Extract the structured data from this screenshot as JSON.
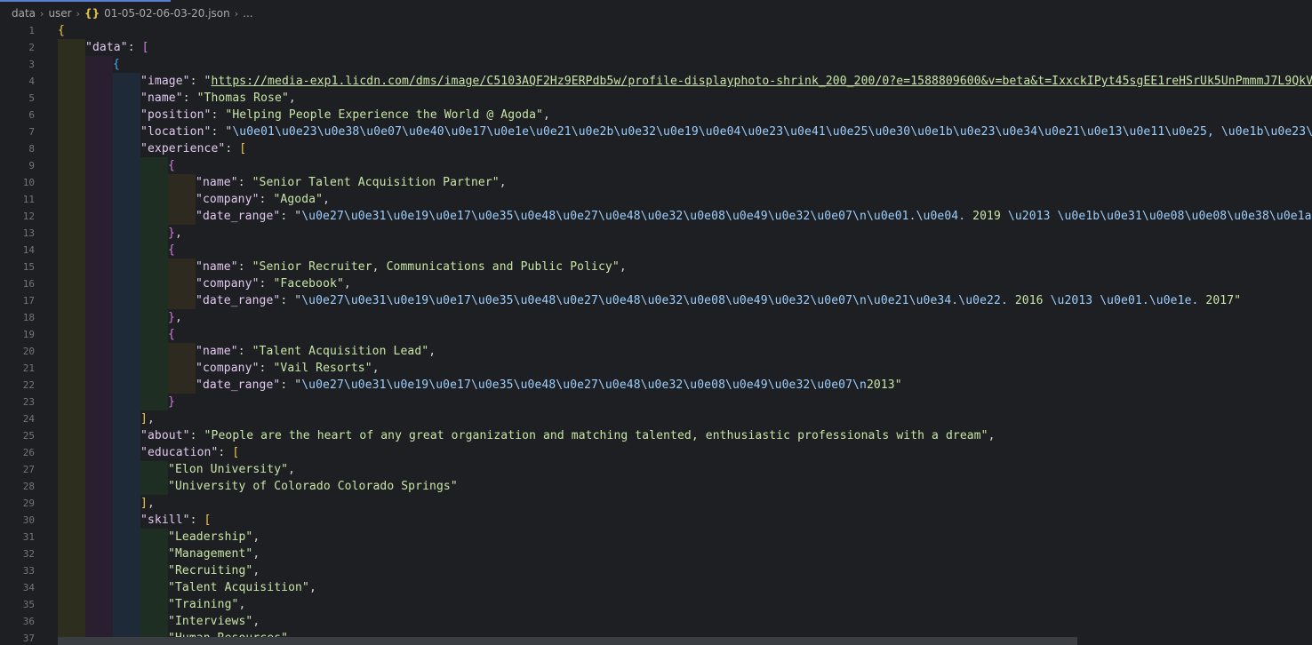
{
  "breadcrumb": {
    "items": [
      "data",
      "user"
    ],
    "file_icon": "{}",
    "file_name": "01-05-02-06-03-20.json",
    "ellipsis": "..."
  },
  "code_lines": [
    {
      "n": 1,
      "indent": 0,
      "tokens": [
        [
          "b1",
          "{"
        ]
      ]
    },
    {
      "n": 2,
      "indent": 1,
      "tokens": [
        [
          "k",
          "\"data\""
        ],
        [
          "p",
          ": "
        ],
        [
          "b2",
          "["
        ]
      ]
    },
    {
      "n": 3,
      "indent": 2,
      "tokens": [
        [
          "b3",
          "{"
        ]
      ]
    },
    {
      "n": 4,
      "indent": 3,
      "tokens": [
        [
          "k",
          "\"image\""
        ],
        [
          "p",
          ": \""
        ],
        [
          "url",
          "https://media-exp1.licdn.com/dms/image/C5103AQF2Hz9ERPdb5w/profile-displayphoto-shrink_200_200/0?e=1588809600&v=beta&t=IxxckIPyt45sgEE1reHSrUk5UnPmmmJ7L9QkV9q3TJ"
        ]
      ]
    },
    {
      "n": 5,
      "indent": 3,
      "tokens": [
        [
          "k",
          "\"name\""
        ],
        [
          "p",
          ": "
        ],
        [
          "s",
          "\"Thomas Rose\""
        ],
        [
          "p",
          ","
        ]
      ]
    },
    {
      "n": 6,
      "indent": 3,
      "tokens": [
        [
          "k",
          "\"position\""
        ],
        [
          "p",
          ": "
        ],
        [
          "s",
          "\"Helping People Experience the World @ Agoda\""
        ],
        [
          "p",
          ","
        ]
      ]
    },
    {
      "n": 7,
      "indent": 3,
      "tokens": [
        [
          "k",
          "\"location\""
        ],
        [
          "p",
          ": \""
        ],
        [
          "u",
          "\\u0e01\\u0e23\\u0e38\\u0e07\\u0e40\\u0e17\\u0e1e\\u0e21\\u0e2b\\u0e32\\u0e19\\u0e04\\u0e23\\u0e41\\u0e25\\u0e30\\u0e1b\\u0e23\\u0e34\\u0e21\\u0e13\\u0e11\\u0e25, \\u0e1b\\u0e23\\u0e30"
        ]
      ]
    },
    {
      "n": 8,
      "indent": 3,
      "tokens": [
        [
          "k",
          "\"experience\""
        ],
        [
          "p",
          ": "
        ],
        [
          "b1",
          "["
        ]
      ]
    },
    {
      "n": 9,
      "indent": 4,
      "tokens": [
        [
          "b2",
          "{"
        ]
      ]
    },
    {
      "n": 10,
      "indent": 5,
      "tokens": [
        [
          "k",
          "\"name\""
        ],
        [
          "p",
          ": "
        ],
        [
          "s",
          "\"Senior Talent Acquisition Partner\""
        ],
        [
          "p",
          ","
        ]
      ]
    },
    {
      "n": 11,
      "indent": 5,
      "tokens": [
        [
          "k",
          "\"company\""
        ],
        [
          "p",
          ": "
        ],
        [
          "s",
          "\"Agoda\""
        ],
        [
          "p",
          ","
        ]
      ]
    },
    {
      "n": 12,
      "indent": 5,
      "tokens": [
        [
          "k",
          "\"date_range\""
        ],
        [
          "p",
          ": \""
        ],
        [
          "u",
          "\\u0e27\\u0e31\\u0e19\\u0e17\\u0e35\\u0e48\\u0e27\\u0e48\\u0e32\\u0e08\\u0e49\\u0e32\\u0e07\\n\\u0e01.\\u0e04."
        ],
        [
          "s",
          " 2019 "
        ],
        [
          "u",
          "\\u2013 \\u0e1b\\u0e31\\u0e08\\u0e08\\u0e38\\u0e1a\\u0e31"
        ]
      ]
    },
    {
      "n": 13,
      "indent": 4,
      "tokens": [
        [
          "b2",
          "}"
        ],
        [
          "p",
          ","
        ]
      ]
    },
    {
      "n": 14,
      "indent": 4,
      "tokens": [
        [
          "b2",
          "{"
        ]
      ]
    },
    {
      "n": 15,
      "indent": 5,
      "tokens": [
        [
          "k",
          "\"name\""
        ],
        [
          "p",
          ": "
        ],
        [
          "s",
          "\"Senior Recruiter, Communications and Public Policy\""
        ],
        [
          "p",
          ","
        ]
      ]
    },
    {
      "n": 16,
      "indent": 5,
      "tokens": [
        [
          "k",
          "\"company\""
        ],
        [
          "p",
          ": "
        ],
        [
          "s",
          "\"Facebook\""
        ],
        [
          "p",
          ","
        ]
      ]
    },
    {
      "n": 17,
      "indent": 5,
      "tokens": [
        [
          "k",
          "\"date_range\""
        ],
        [
          "p",
          ": \""
        ],
        [
          "u",
          "\\u0e27\\u0e31\\u0e19\\u0e17\\u0e35\\u0e48\\u0e27\\u0e48\\u0e32\\u0e08\\u0e49\\u0e32\\u0e07\\n\\u0e21\\u0e34.\\u0e22."
        ],
        [
          "s",
          " 2016 "
        ],
        [
          "u",
          "\\u2013 \\u0e01.\\u0e1e."
        ],
        [
          "s",
          " 2017\""
        ]
      ]
    },
    {
      "n": 18,
      "indent": 4,
      "tokens": [
        [
          "b2",
          "}"
        ],
        [
          "p",
          ","
        ]
      ]
    },
    {
      "n": 19,
      "indent": 4,
      "tokens": [
        [
          "b2",
          "{"
        ]
      ]
    },
    {
      "n": 20,
      "indent": 5,
      "tokens": [
        [
          "k",
          "\"name\""
        ],
        [
          "p",
          ": "
        ],
        [
          "s",
          "\"Talent Acquisition Lead\""
        ],
        [
          "p",
          ","
        ]
      ]
    },
    {
      "n": 21,
      "indent": 5,
      "tokens": [
        [
          "k",
          "\"company\""
        ],
        [
          "p",
          ": "
        ],
        [
          "s",
          "\"Vail Resorts\""
        ],
        [
          "p",
          ","
        ]
      ]
    },
    {
      "n": 22,
      "indent": 5,
      "tokens": [
        [
          "k",
          "\"date_range\""
        ],
        [
          "p",
          ": \""
        ],
        [
          "u",
          "\\u0e27\\u0e31\\u0e19\\u0e17\\u0e35\\u0e48\\u0e27\\u0e48\\u0e32\\u0e08\\u0e49\\u0e32\\u0e07\\n"
        ],
        [
          "s",
          "2013\""
        ]
      ]
    },
    {
      "n": 23,
      "indent": 4,
      "tokens": [
        [
          "b2",
          "}"
        ]
      ]
    },
    {
      "n": 24,
      "indent": 3,
      "tokens": [
        [
          "b1",
          "]"
        ],
        [
          "p",
          ","
        ]
      ]
    },
    {
      "n": 25,
      "indent": 3,
      "tokens": [
        [
          "k",
          "\"about\""
        ],
        [
          "p",
          ": "
        ],
        [
          "s",
          "\"People are the heart of any great organization and matching talented, enthusiastic professionals with a dream\""
        ],
        [
          "p",
          ","
        ]
      ]
    },
    {
      "n": 26,
      "indent": 3,
      "tokens": [
        [
          "k",
          "\"education\""
        ],
        [
          "p",
          ": "
        ],
        [
          "b1",
          "["
        ]
      ]
    },
    {
      "n": 27,
      "indent": 4,
      "tokens": [
        [
          "s",
          "\"Elon University\""
        ],
        [
          "p",
          ","
        ]
      ]
    },
    {
      "n": 28,
      "indent": 4,
      "tokens": [
        [
          "s",
          "\"University of Colorado Colorado Springs\""
        ]
      ]
    },
    {
      "n": 29,
      "indent": 3,
      "tokens": [
        [
          "b1",
          "]"
        ],
        [
          "p",
          ","
        ]
      ]
    },
    {
      "n": 30,
      "indent": 3,
      "tokens": [
        [
          "k",
          "\"skill\""
        ],
        [
          "p",
          ": "
        ],
        [
          "b1",
          "["
        ]
      ]
    },
    {
      "n": 31,
      "indent": 4,
      "tokens": [
        [
          "s",
          "\"Leadership\""
        ],
        [
          "p",
          ","
        ]
      ]
    },
    {
      "n": 32,
      "indent": 4,
      "tokens": [
        [
          "s",
          "\"Management\""
        ],
        [
          "p",
          ","
        ]
      ]
    },
    {
      "n": 33,
      "indent": 4,
      "tokens": [
        [
          "s",
          "\"Recruiting\""
        ],
        [
          "p",
          ","
        ]
      ]
    },
    {
      "n": 34,
      "indent": 4,
      "tokens": [
        [
          "s",
          "\"Talent Acquisition\""
        ],
        [
          "p",
          ","
        ]
      ]
    },
    {
      "n": 35,
      "indent": 4,
      "tokens": [
        [
          "s",
          "\"Training\""
        ],
        [
          "p",
          ","
        ]
      ]
    },
    {
      "n": 36,
      "indent": 4,
      "tokens": [
        [
          "s",
          "\"Interviews\""
        ],
        [
          "p",
          ","
        ]
      ]
    },
    {
      "n": 37,
      "indent": 4,
      "tokens": [
        [
          "s",
          "\"Human Resources\""
        ],
        [
          "p",
          ","
        ]
      ]
    }
  ],
  "indent_guide_colors": [
    "#2e2e1e",
    "#2a1f30",
    "#1f2a38",
    "#1e2e22",
    "#2e2a20",
    "#2a2436"
  ],
  "colors": {
    "background": "#1e1f22",
    "key": "#e1c8f0",
    "string": "#c8e6a7",
    "escape": "#9ccfff",
    "bracket_level_1": "#f2c94c",
    "bracket_level_2": "#d27be0",
    "bracket_level_3": "#4aa8ff",
    "line_number": "#6e7681"
  }
}
